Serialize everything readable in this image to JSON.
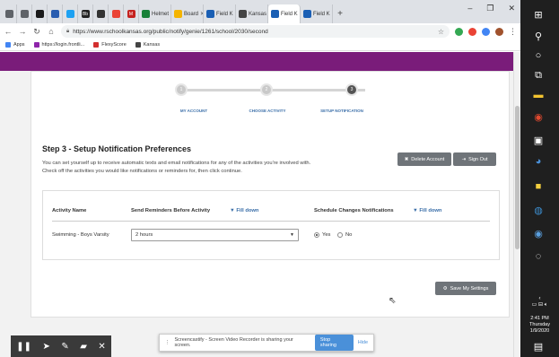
{
  "browser": {
    "tabs": [
      {
        "label": "",
        "icon": "chrome-icon",
        "color": "#5f6368"
      },
      {
        "label": "",
        "icon": "chrome-icon",
        "color": "#5f6368"
      },
      {
        "label": "",
        "icon": "app-icon",
        "color": "#1a1a1a"
      },
      {
        "label": "",
        "icon": "rschool-icon",
        "color": "#2a5db0"
      },
      {
        "label": "",
        "icon": "twitter-icon",
        "color": "#1da1f2"
      },
      {
        "label": "Bb",
        "icon": "blackboard-icon",
        "color": "#222"
      },
      {
        "label": "",
        "icon": "app-icon",
        "color": "#333"
      },
      {
        "label": "",
        "icon": "google-icon",
        "color": "#ea4335"
      },
      {
        "label": "M",
        "icon": "gmail-icon",
        "color": "#c5221f"
      }
    ],
    "wide_tabs": [
      {
        "label": "Helmet",
        "icon": "sheets-icon",
        "color": "#188038",
        "active": false
      },
      {
        "label": "Board",
        "icon": "slides-icon",
        "color": "#f4b400",
        "active": false
      },
      {
        "label": "Field K",
        "icon": "field-icon",
        "color": "#1a5fb4",
        "active": false
      },
      {
        "label": "Kansas",
        "icon": "kansas-icon",
        "color": "#444",
        "active": false
      },
      {
        "label": "Field K",
        "icon": "field-icon",
        "color": "#1a5fb4",
        "active": true
      },
      {
        "label": "Field K",
        "icon": "field-icon",
        "color": "#1a5fb4",
        "active": false
      }
    ],
    "url": "https://www.rschoolkansas.org/public/notify/genie/1261/school/2030/second",
    "bookmarks": [
      {
        "label": "Apps",
        "color": "#4285f4"
      },
      {
        "label": "https://login.frontli...",
        "color": "#8e24aa"
      },
      {
        "label": "FlexyScore",
        "color": "#d32f2f"
      },
      {
        "label": "Kansas",
        "color": "#444"
      }
    ]
  },
  "steps": [
    {
      "number": "1",
      "label": "MY ACCOUNT"
    },
    {
      "number": "2",
      "label": "CHOOSE ACTIVITY"
    },
    {
      "number": "3",
      "label": "SETUP NOTIFICATION"
    }
  ],
  "main": {
    "heading": "Step 3 - Setup Notification Preferences",
    "description": "You can set yourself up to receive automatic texts and email notifications for any of the activities you're involved with. Check off the activities you would like notifications or reminders for, then click continue.",
    "delete_account": "Delete Account",
    "sign_out": "Sign Out",
    "save_settings": "Save My Settings"
  },
  "table": {
    "col_activity": "Activity Name",
    "col_reminders": "Send Reminders Before Activity",
    "fill_down_1": "▼ Fill down",
    "col_schedule": "Schedule Changes Notifications",
    "fill_down_2": "▼ Fill down",
    "row_activity": "Swimming - Boys Varsity",
    "row_reminder": "2 hours",
    "yes": "Yes",
    "no": "No"
  },
  "overlay": {
    "share_text": "Screencastify - Screen Video Recorder is sharing your screen.",
    "stop_sharing": "Stop sharing",
    "hide": "Hide"
  },
  "taskbar": {
    "time": "2:41 PM",
    "day": "Thursday",
    "date": "1/9/2020"
  }
}
